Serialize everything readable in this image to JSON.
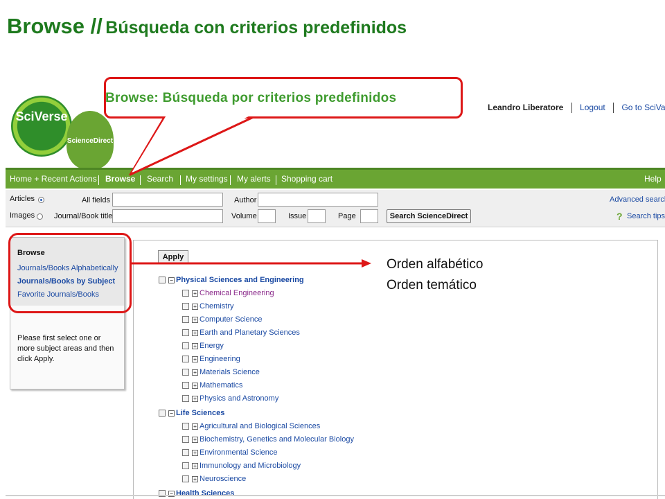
{
  "slide": {
    "title_main": "Browse //",
    "title_sub": "Búsqueda con criterios predefinidos"
  },
  "callout": {
    "text": "Browse: Búsqueda por criterios predefinidos"
  },
  "notes": [
    "Orden alfabético",
    "Orden temático"
  ],
  "logo": {
    "primary": "SciVerse",
    "secondary": "ScienceDirect"
  },
  "user_bar": {
    "username": "Leandro Liberatore",
    "logout": "Logout",
    "goto": "Go to SciVal Suite"
  },
  "nav": {
    "items": [
      "Home + Recent Actions",
      "Browse",
      "Search",
      "My settings",
      "My alerts",
      "Shopping cart"
    ],
    "active": "Browse",
    "help": "Help"
  },
  "search": {
    "type_articles": "Articles",
    "type_images": "Images",
    "all_fields": "All fields",
    "author": "Author",
    "journal_title": "Journal/Book title",
    "volume": "Volume",
    "issue": "Issue",
    "page": "Page",
    "button": "Search ScienceDirect",
    "advanced": "Advanced search",
    "tips": "Search tips"
  },
  "sidebar": {
    "heading": "Browse",
    "links": [
      "Journals/Books Alphabetically",
      "Journals/Books by Subject",
      "Favorite Journals/Books"
    ],
    "message": "Please first select one or more subject areas and then click Apply."
  },
  "main": {
    "apply": "Apply",
    "categories": [
      {
        "name": "Physical Sciences and Engineering",
        "subs": [
          "Chemical Engineering",
          "Chemistry",
          "Computer Science",
          "Earth and Planetary Sciences",
          "Energy",
          "Engineering",
          "Materials Science",
          "Mathematics",
          "Physics and Astronomy"
        ]
      },
      {
        "name": "Life Sciences",
        "subs": [
          "Agricultural and Biological Sciences",
          "Biochemistry, Genetics and Molecular Biology",
          "Environmental Science",
          "Immunology and Microbiology",
          "Neuroscience"
        ]
      },
      {
        "name": "Health Sciences",
        "subs": []
      }
    ]
  },
  "colors": {
    "accent_green": "#6aa533",
    "title_green": "#1e7a1e",
    "highlight_red": "#dd1717",
    "link_blue": "#1b4aa3"
  },
  "icons": [
    "radio-icon",
    "checkbox-icon",
    "expand-icon",
    "collapse-icon",
    "help-question-icon"
  ]
}
